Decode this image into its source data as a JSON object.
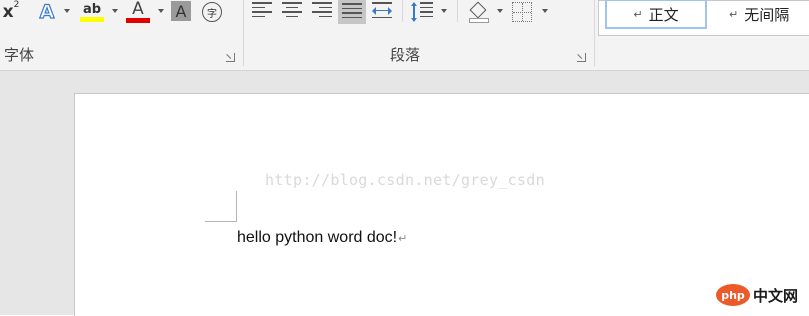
{
  "ribbon": {
    "font_group": {
      "label": "字体",
      "superscript_glyph": "x",
      "superscript_mark": "2",
      "text_effects_glyph": "A",
      "highlight_glyph": "ab",
      "font_color_glyph": "A",
      "char_shading_glyph": "A",
      "enclose_char_glyph": "字",
      "highlight_color": "#ffff00",
      "font_color": "#e00000"
    },
    "paragraph_group": {
      "label": "段落"
    },
    "styles": {
      "items": [
        "正文",
        "无间隔"
      ],
      "return_glyph": "↵"
    }
  },
  "document": {
    "watermark": "http://blog.csdn.net/grey_csdn",
    "text": "hello python word doc!",
    "paragraph_mark": "↵"
  },
  "brand": {
    "logo_text": "php",
    "site_name": "中文网"
  }
}
